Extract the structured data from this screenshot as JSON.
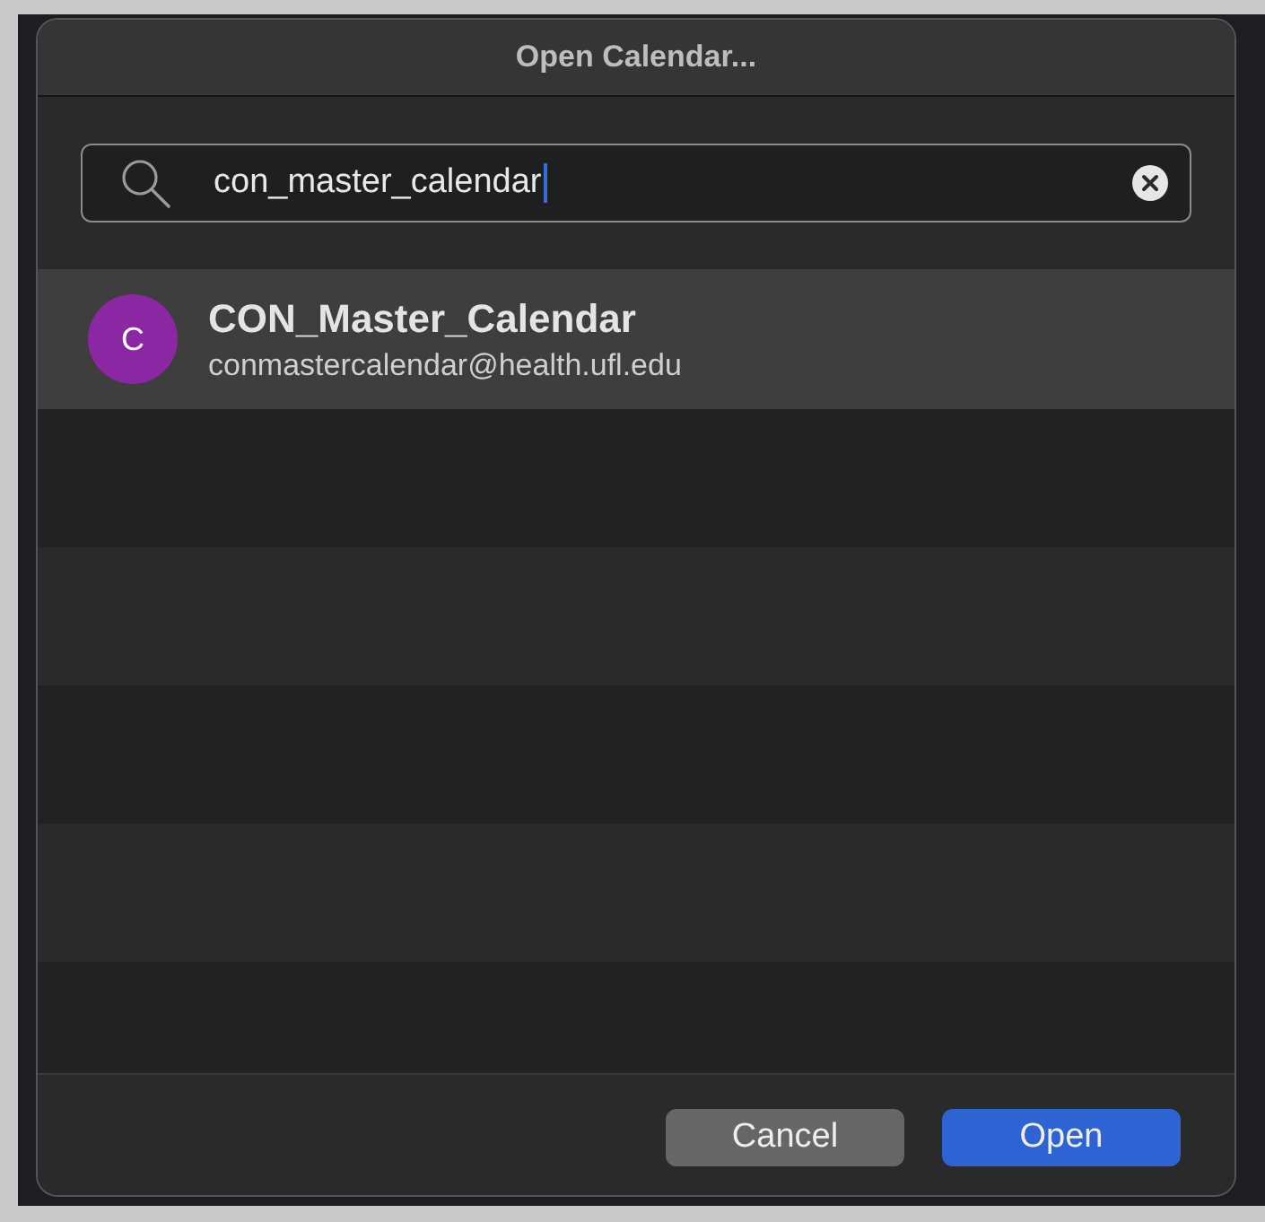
{
  "dialog": {
    "title": "Open Calendar..."
  },
  "search": {
    "value": "con_master_calendar"
  },
  "results": [
    {
      "initial": "C",
      "name": "CON_Master_Calendar",
      "email": "conmastercalendar@health.ufl.edu",
      "color": "#8c27a3",
      "selected": true
    }
  ],
  "buttons": [
    {
      "label": "Cancel",
      "kind": "secondary"
    },
    {
      "label": "Open",
      "kind": "primary"
    }
  ]
}
